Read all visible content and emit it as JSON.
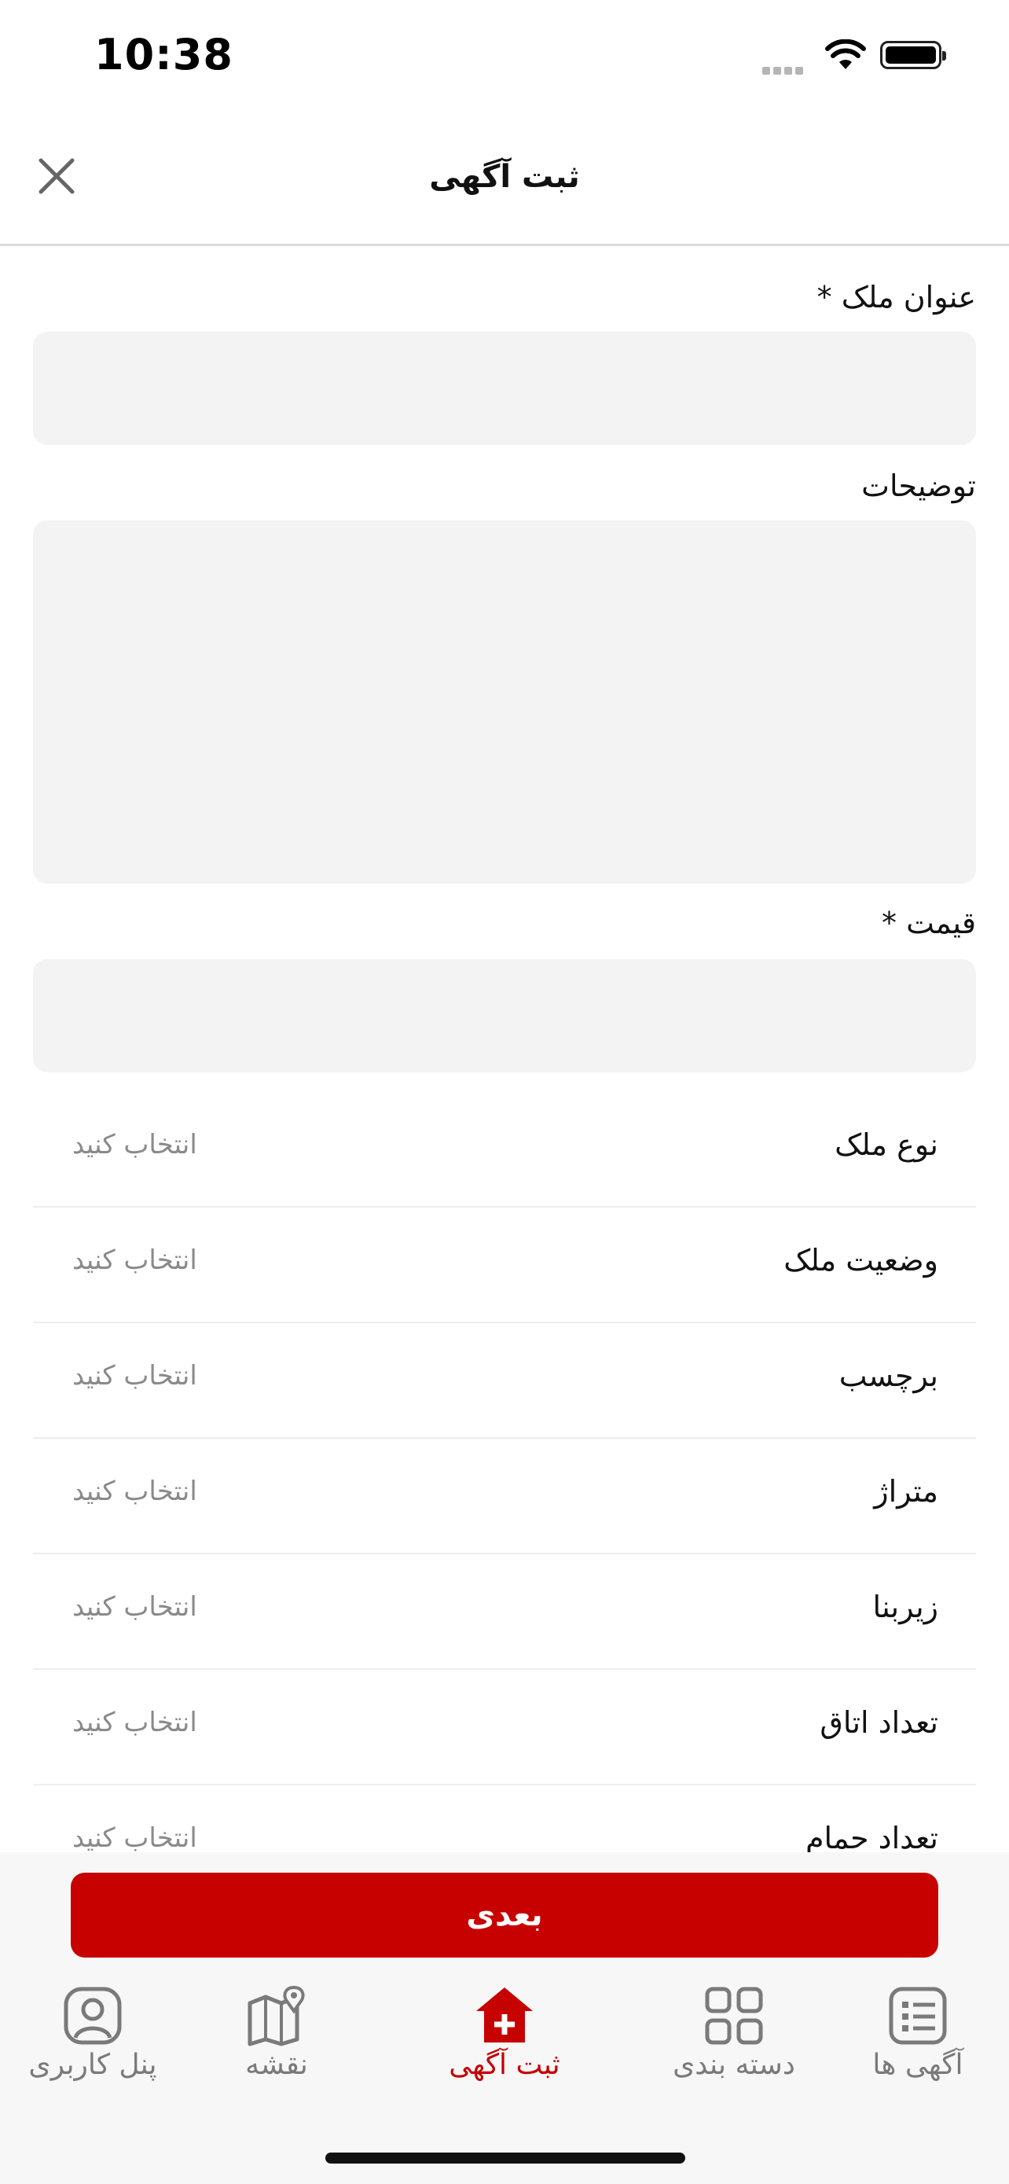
{
  "status_bar": {
    "time": "10:38"
  },
  "header": {
    "title": "ثبت آگهی"
  },
  "form": {
    "title_label": "عنوان ملک *",
    "description_label": "توضیحات",
    "price_label": "قیمت *",
    "selects": [
      {
        "label": "نوع ملک",
        "value": "انتخاب کنید"
      },
      {
        "label": "وضعیت ملک",
        "value": "انتخاب کنید"
      },
      {
        "label": "برچسب",
        "value": "انتخاب کنید"
      },
      {
        "label": "متراژ",
        "value": "انتخاب کنید"
      },
      {
        "label": "زیربنا",
        "value": "انتخاب کنید"
      },
      {
        "label": "تعداد اتاق",
        "value": "انتخاب کنید"
      },
      {
        "label": "تعداد حمام",
        "value": "انتخاب کنید"
      }
    ]
  },
  "next_button": "بعدی",
  "tabs": [
    {
      "label": "پنل کاربری",
      "icon": "user-icon"
    },
    {
      "label": "نقشه",
      "icon": "map-icon"
    },
    {
      "label": "ثبت آگهی",
      "icon": "add-home-icon",
      "active": true
    },
    {
      "label": "دسته بندی",
      "icon": "grid-icon"
    },
    {
      "label": "آگهی ها",
      "icon": "list-icon"
    }
  ],
  "colors": {
    "accent": "#c70000",
    "field_bg": "#f3f3f3",
    "muted": "#8a8a8a"
  }
}
